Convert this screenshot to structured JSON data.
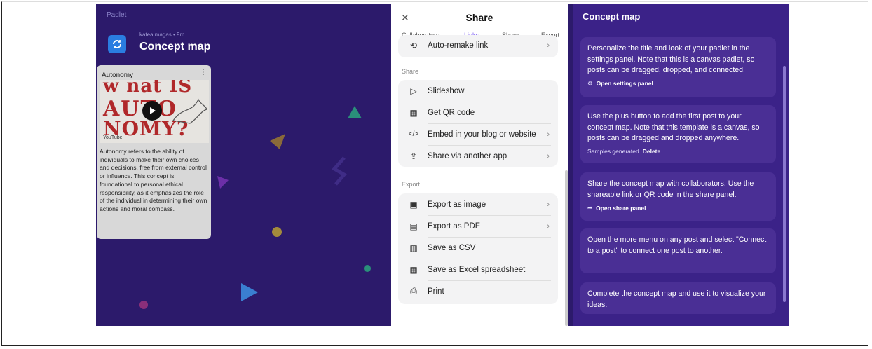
{
  "canvas": {
    "brand": "Padlet",
    "author_line": "katea magas • 9m",
    "title": "Concept map",
    "post": {
      "title": "Autonomy",
      "thumb_lines": [
        "w nat  IS",
        "AUTO",
        "NOMY?"
      ],
      "source": "YouTube",
      "body": "Autonomy refers to the ability of individuals to make their own choices and decisions, free from external control or influence. This concept is foundational to personal ethical responsibility, as it emphasizes the role of the individual in determining their own actions and moral compass."
    }
  },
  "share": {
    "title": "Share",
    "tabs": [
      "Collaborators",
      "Links",
      "Share",
      "Export"
    ],
    "active_tab": "Links",
    "links_items": [
      {
        "label": "Auto-remake link",
        "icon": "link-refresh-icon",
        "chevron": true
      }
    ],
    "share_section_label": "Share",
    "share_items": [
      {
        "label": "Slideshow",
        "icon": "play-outline-icon",
        "chevron": false
      },
      {
        "label": "Get QR code",
        "icon": "qr-code-icon",
        "chevron": false
      },
      {
        "label": "Embed in your blog or website",
        "icon": "code-icon",
        "chevron": true
      },
      {
        "label": "Share via another app",
        "icon": "share-icon",
        "chevron": true
      }
    ],
    "export_section_label": "Export",
    "export_items": [
      {
        "label": "Export as image",
        "icon": "image-icon",
        "chevron": true
      },
      {
        "label": "Export as PDF",
        "icon": "pdf-icon",
        "chevron": true
      },
      {
        "label": "Save as CSV",
        "icon": "csv-icon",
        "chevron": false
      },
      {
        "label": "Save as Excel spreadsheet",
        "icon": "spreadsheet-icon",
        "chevron": false
      },
      {
        "label": "Print",
        "icon": "printer-icon",
        "chevron": false
      }
    ]
  },
  "info": {
    "title": "Concept map",
    "cards": [
      {
        "text": "Personalize the title and look of your padlet in the settings panel. Note that this is a canvas padlet, so posts can be dragged, dropped, and connected.",
        "action": "Open settings panel",
        "action_icon": "gear-icon"
      },
      {
        "text": "Use the plus button to add the first post to your concept map. Note that this template is a canvas, so posts can be dragged and dropped anywhere.",
        "action_prefix": "Samples generated",
        "action": "Delete"
      },
      {
        "text": "Share the concept map with collaborators. Use the shareable link or QR code in the share panel.",
        "action": "Open share panel",
        "action_icon": "share-arrow-icon"
      },
      {
        "text": "Open the more menu on any post and select \"Connect to a post\" to connect one post to another."
      },
      {
        "text": "Complete the concept map and use it to visualize your ideas."
      }
    ]
  }
}
